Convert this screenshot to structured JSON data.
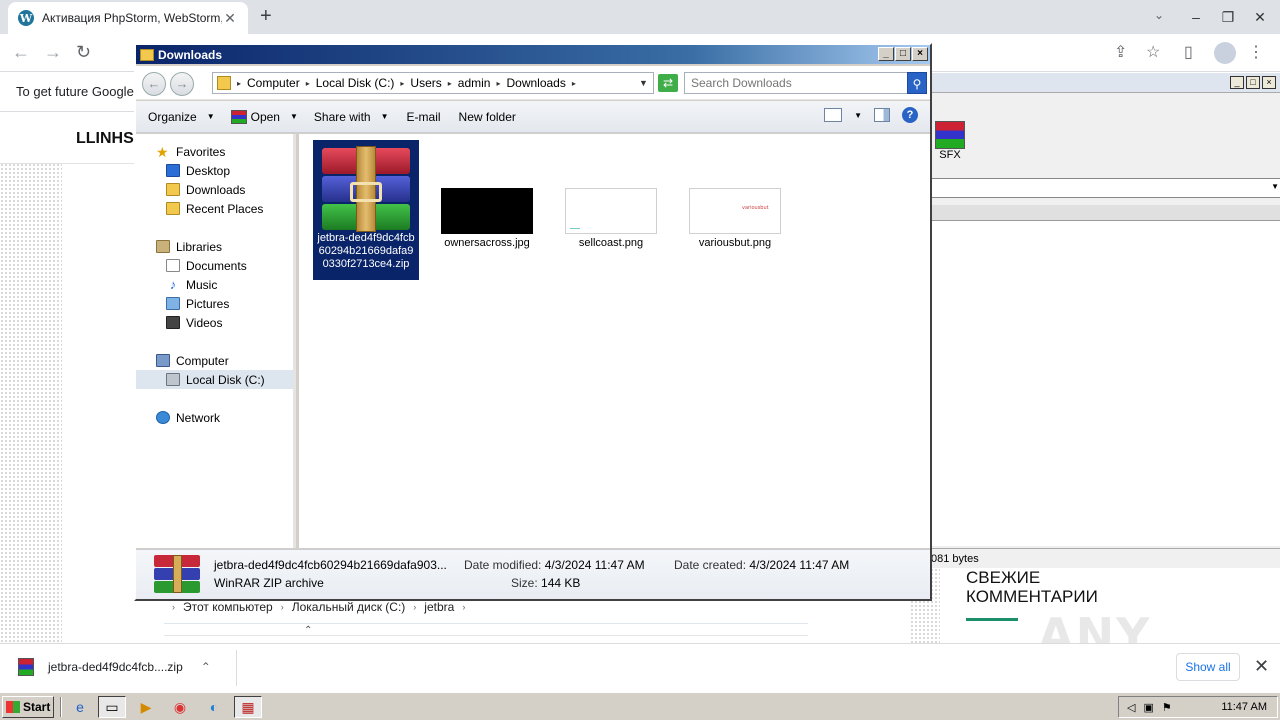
{
  "browser": {
    "tab_title": "Активация PhpStorm, WebStorm, I",
    "tab_close": "✕",
    "new_tab": "+",
    "infobar_text": "To get future Google Chrome updates",
    "page_site_title": "LLINHS"
  },
  "background_explorer": {
    "breadcrumbs": [
      "Этот компьютер",
      "Локальный диск (C:)",
      "jetbra"
    ]
  },
  "background_page": {
    "comments_title_line1": "СВЕЖИЕ",
    "comments_title_line2": "КОММЕНТАРИИ"
  },
  "winrar": {
    "sfx_label": "SFX",
    "status_text": "081 bytes"
  },
  "explorer": {
    "title": "Downloads",
    "address": [
      "Computer",
      "Local Disk (C:)",
      "Users",
      "admin",
      "Downloads"
    ],
    "search_placeholder": "Search Downloads",
    "toolbar": {
      "organize": "Organize",
      "open": "Open",
      "share_with": "Share with",
      "email": "E-mail",
      "new_folder": "New folder"
    },
    "nav": {
      "favorites": "Favorites",
      "desktop": "Desktop",
      "downloads": "Downloads",
      "recent_places": "Recent Places",
      "libraries": "Libraries",
      "documents": "Documents",
      "music": "Music",
      "pictures": "Pictures",
      "videos": "Videos",
      "computer": "Computer",
      "local_disk": "Local Disk (C:)",
      "network": "Network"
    },
    "files": [
      {
        "name": "jetbra-ded4f9dc4fcb60294b21669dafa90330f2713ce4.zip",
        "selected": true
      },
      {
        "name": "ownersacross.jpg"
      },
      {
        "name": "sellcoast.png"
      },
      {
        "name": "variousbut.png"
      }
    ],
    "details": {
      "name": "jetbra-ded4f9dc4fcb60294b21669dafa903...",
      "type": "WinRAR ZIP archive",
      "modified_label": "Date modified:",
      "modified_value": "4/3/2024 11:47 AM",
      "size_label": "Size:",
      "size_value": "144 KB",
      "created_label": "Date created:",
      "created_value": "4/3/2024 11:47 AM"
    }
  },
  "download_bar": {
    "file_name": "jetbra-ded4f9dc4fcb....zip",
    "show_all": "Show all"
  },
  "watermark": "ANY RUN",
  "taskbar": {
    "start": "Start",
    "clock": "11:47 AM"
  }
}
